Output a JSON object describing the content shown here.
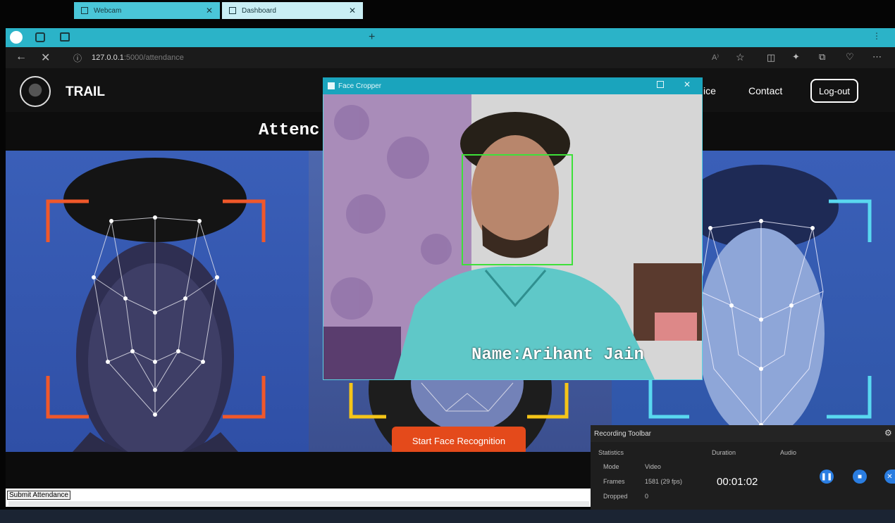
{
  "browser": {
    "tabs": [
      {
        "label": "Webcam"
      },
      {
        "label": "Dashboard"
      }
    ],
    "url_host": "127.0.0.1",
    "url_path": ":5000/attendance",
    "icons": [
      "profile-icon",
      "workspaces-icon",
      "tab-actions-icon",
      "back-icon",
      "stop-icon",
      "info-icon",
      "read-aloud-icon",
      "favorite-icon",
      "split-screen-icon",
      "extensions-icon",
      "collections-icon",
      "browser-essentials-icon",
      "more-icon"
    ]
  },
  "site": {
    "brand": "TRAIL",
    "nav": {
      "service_partial": "ice",
      "contact": "Contact"
    },
    "logout": "Log-out",
    "page_title": "Attenc",
    "start_button": "Start Face Recognition",
    "submit_button": "Submit Attendance"
  },
  "face_cropper": {
    "title": "Face Cropper",
    "recognized_label": "Name:Arihant Jain",
    "box_color": "#3ee03a"
  },
  "recording_toolbar": {
    "title": "Recording Toolbar",
    "statistics_label": "Statistics",
    "duration_label": "Duration",
    "audio_label": "Audio",
    "mode_label": "Mode",
    "mode_value": "Video",
    "frames_label": "Frames",
    "frames_value": "1581 (29 fps)",
    "dropped_label": "Dropped",
    "dropped_value": "0",
    "duration_value": "00:01:02"
  },
  "colors": {
    "tabbar": "#2bb3c8",
    "accent_orange": "#e44a1b",
    "corner_orange": "#f0582a",
    "corner_yellow": "#f5c518",
    "corner_cyan": "#59d8f0"
  }
}
